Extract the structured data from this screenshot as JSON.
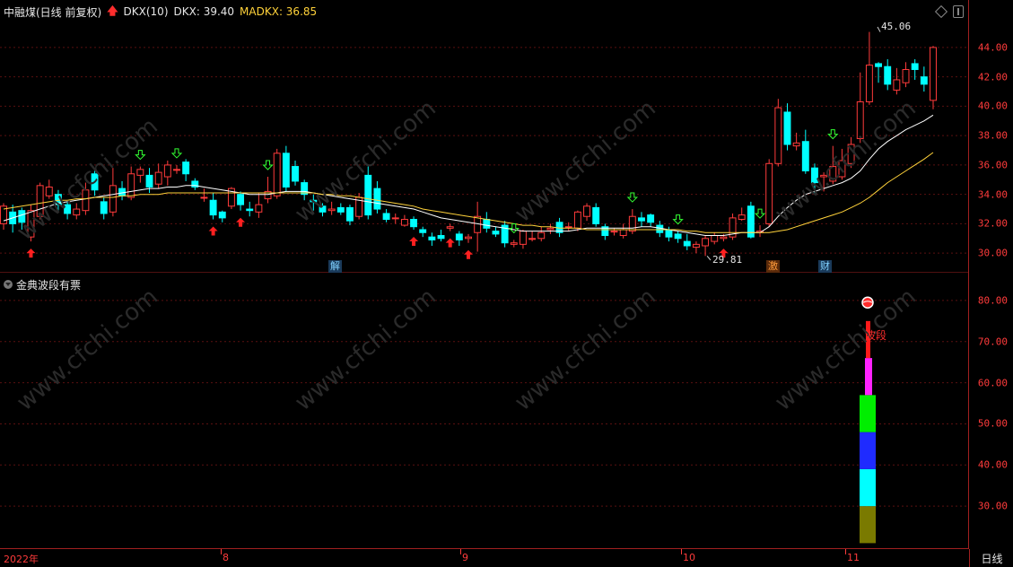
{
  "header": {
    "stock_name": "中融煤(日线 前复权)",
    "indicator_name": "DKX(10)",
    "dkx_label": "DKX: 39.40",
    "madkx_label": "MADKX: 36.85"
  },
  "sub_header": {
    "indicator_name": "金典波段有票"
  },
  "main_axis": [
    "44.00",
    "42.00",
    "40.00",
    "38.00",
    "36.00",
    "34.00",
    "32.00",
    "30.00"
  ],
  "sub_axis": [
    "80.00",
    "70.00",
    "60.00",
    "50.00",
    "40.00",
    "30.00"
  ],
  "dates": [
    "2022年",
    "8",
    "9",
    "10",
    "11"
  ],
  "period": "日线",
  "annotations": {
    "high": "45.06",
    "low": "29.81"
  },
  "markers": {
    "jie": "解",
    "ji": "激",
    "cai": "财"
  },
  "boduan_label": "波段",
  "watermark": "www.cfchi.com",
  "colors": {
    "up": "#ff3b3b",
    "down": "#00ffff",
    "dkx": "#ffffff",
    "madkx": "#ffd23a"
  },
  "chart_data": {
    "type": "candlestick",
    "ylim": [
      29.4,
      45.4
    ],
    "candles": [
      [
        32.0,
        33.2,
        33.4,
        31.6
      ],
      [
        32.8,
        32.0,
        33.3,
        31.4
      ],
      [
        32.9,
        32.1,
        33.1,
        31.6
      ],
      [
        31.1,
        32.9,
        33.3,
        30.8
      ],
      [
        32.5,
        34.6,
        34.8,
        32.3
      ],
      [
        33.9,
        34.5,
        35.0,
        33.7
      ],
      [
        34.0,
        33.3,
        34.3,
        32.9
      ],
      [
        33.3,
        32.7,
        33.5,
        32.3
      ],
      [
        32.6,
        33.0,
        33.4,
        32.3
      ],
      [
        32.9,
        34.3,
        34.8,
        32.6
      ],
      [
        35.4,
        34.3,
        35.6,
        33.9
      ],
      [
        33.5,
        32.7,
        33.8,
        32.3
      ],
      [
        32.8,
        34.6,
        35.8,
        32.5
      ],
      [
        34.4,
        33.9,
        34.9,
        33.6
      ],
      [
        33.8,
        35.4,
        35.9,
        33.6
      ],
      [
        35.3,
        35.7,
        35.9,
        34.8
      ],
      [
        35.3,
        34.5,
        35.8,
        34.1
      ],
      [
        34.7,
        35.5,
        36.1,
        34.4
      ],
      [
        35.2,
        36.0,
        36.3,
        34.6
      ],
      [
        35.7,
        35.7,
        36.0,
        35.4
      ],
      [
        36.2,
        35.4,
        36.4,
        34.9
      ],
      [
        34.9,
        34.5,
        35.1,
        34.3
      ],
      [
        33.8,
        33.8,
        34.4,
        33.5
      ],
      [
        33.6,
        32.6,
        34.1,
        32.3
      ],
      [
        32.8,
        32.4,
        32.9,
        32.1
      ],
      [
        33.2,
        34.4,
        34.5,
        33.0
      ],
      [
        34.0,
        33.3,
        34.2,
        32.9
      ],
      [
        33.0,
        32.9,
        33.5,
        32.5
      ],
      [
        32.8,
        33.3,
        34.1,
        32.4
      ],
      [
        33.7,
        34.2,
        35.2,
        33.4
      ],
      [
        33.9,
        36.8,
        37.1,
        33.7
      ],
      [
        36.8,
        34.5,
        37.3,
        34.2
      ],
      [
        35.9,
        34.9,
        36.3,
        34.6
      ],
      [
        34.8,
        34.0,
        35.0,
        33.6
      ],
      [
        33.6,
        33.5,
        34.0,
        32.9
      ],
      [
        33.2,
        32.8,
        33.4,
        32.5
      ],
      [
        32.9,
        33.0,
        33.5,
        32.6
      ],
      [
        33.1,
        32.8,
        33.4,
        32.6
      ],
      [
        33.1,
        32.2,
        33.3,
        31.9
      ],
      [
        32.5,
        33.8,
        34.1,
        32.3
      ],
      [
        35.3,
        32.6,
        35.9,
        32.3
      ],
      [
        34.4,
        33.0,
        34.9,
        32.7
      ],
      [
        32.7,
        32.3,
        33.0,
        32.1
      ],
      [
        32.4,
        32.4,
        32.7,
        32.0
      ],
      [
        31.9,
        32.3,
        32.6,
        31.8
      ],
      [
        32.3,
        31.8,
        32.5,
        31.6
      ],
      [
        31.6,
        31.4,
        31.8,
        31.1
      ],
      [
        31.1,
        30.9,
        31.4,
        30.5
      ],
      [
        31.2,
        31.0,
        31.6,
        30.8
      ],
      [
        31.7,
        31.8,
        32.0,
        31.5
      ],
      [
        31.3,
        30.9,
        31.5,
        30.5
      ],
      [
        31.0,
        31.1,
        31.3,
        30.7
      ],
      [
        31.4,
        32.5,
        33.5,
        30.1
      ],
      [
        32.3,
        31.7,
        32.8,
        31.4
      ],
      [
        31.5,
        31.3,
        31.8,
        31.1
      ],
      [
        31.9,
        30.7,
        32.2,
        30.4
      ],
      [
        30.6,
        30.7,
        30.9,
        30.4
      ],
      [
        30.6,
        31.5,
        31.6,
        30.3
      ],
      [
        31.0,
        31.0,
        31.5,
        30.8
      ],
      [
        31.0,
        31.4,
        31.8,
        30.8
      ],
      [
        31.6,
        31.7,
        32.0,
        31.3
      ],
      [
        32.1,
        31.4,
        32.4,
        31.1
      ],
      [
        31.8,
        31.8,
        32.1,
        31.5
      ],
      [
        31.7,
        32.8,
        32.9,
        31.5
      ],
      [
        32.5,
        33.2,
        33.4,
        32.2
      ],
      [
        33.1,
        32.0,
        33.4,
        31.8
      ],
      [
        31.8,
        31.2,
        32.0,
        30.9
      ],
      [
        31.5,
        31.5,
        31.7,
        31.2
      ],
      [
        31.2,
        31.6,
        32.0,
        31.0
      ],
      [
        31.5,
        32.5,
        33.0,
        31.3
      ],
      [
        32.4,
        32.2,
        32.8,
        31.8
      ],
      [
        32.6,
        32.1,
        32.7,
        31.8
      ],
      [
        31.9,
        31.4,
        32.2,
        31.1
      ],
      [
        31.6,
        31.1,
        31.8,
        30.8
      ],
      [
        31.3,
        31.0,
        31.5,
        30.7
      ],
      [
        30.8,
        30.5,
        31.3,
        30.2
      ],
      [
        30.4,
        30.6,
        30.8,
        30.0
      ],
      [
        30.5,
        31.0,
        31.2,
        29.81
      ],
      [
        30.8,
        31.2,
        31.4,
        30.6
      ],
      [
        31.0,
        31.1,
        31.3,
        30.8
      ],
      [
        31.1,
        32.4,
        32.7,
        30.9
      ],
      [
        32.3,
        32.6,
        33.1,
        32.2
      ],
      [
        33.2,
        31.1,
        33.5,
        31.0
      ],
      [
        31.4,
        31.5,
        31.9,
        31.1
      ],
      [
        32.0,
        36.1,
        36.4,
        31.8
      ],
      [
        36.1,
        39.9,
        40.5,
        35.9
      ],
      [
        39.6,
        37.4,
        40.2,
        37.0
      ],
      [
        37.3,
        37.5,
        38.2,
        37.0
      ],
      [
        37.6,
        35.6,
        38.4,
        35.4
      ],
      [
        35.8,
        34.8,
        36.1,
        34.1
      ],
      [
        35.2,
        35.3,
        35.5,
        34.2
      ],
      [
        34.9,
        35.9,
        37.3,
        34.7
      ],
      [
        35.2,
        36.3,
        37.1,
        35.0
      ],
      [
        36.1,
        37.4,
        37.9,
        35.8
      ],
      [
        37.8,
        40.3,
        42.3,
        37.5
      ],
      [
        40.3,
        42.8,
        45.06,
        40.1
      ],
      [
        42.9,
        42.7,
        43.0,
        41.6
      ],
      [
        42.7,
        41.5,
        43.2,
        41.1
      ],
      [
        41.1,
        41.8,
        42.6,
        40.8
      ],
      [
        41.6,
        42.5,
        43.0,
        41.3
      ],
      [
        42.9,
        42.5,
        43.2,
        41.8
      ],
      [
        42.0,
        41.5,
        42.7,
        41.0
      ],
      [
        40.4,
        44.0,
        44.1,
        39.8
      ]
    ],
    "dkx": [
      32.2,
      32.4,
      32.6,
      32.8,
      33.0,
      33.2,
      33.4,
      33.5,
      33.6,
      33.7,
      33.8,
      33.9,
      34.0,
      34.1,
      34.2,
      34.3,
      34.4,
      34.4,
      34.5,
      34.5,
      34.6,
      34.6,
      34.5,
      34.4,
      34.3,
      34.2,
      34.1,
      34.0,
      34.0,
      34.0,
      34.1,
      34.2,
      34.2,
      34.2,
      34.1,
      34.0,
      33.9,
      33.8,
      33.7,
      33.6,
      33.5,
      33.4,
      33.3,
      33.2,
      33.1,
      33.0,
      32.8,
      32.6,
      32.4,
      32.3,
      32.2,
      32.1,
      32.0,
      31.9,
      31.8,
      31.7,
      31.6,
      31.5,
      31.5,
      31.5,
      31.5,
      31.5,
      31.5,
      31.6,
      31.7,
      31.7,
      31.7,
      31.7,
      31.7,
      31.7,
      31.8,
      31.8,
      31.7,
      31.6,
      31.5,
      31.4,
      31.3,
      31.2,
      31.2,
      31.2,
      31.3,
      31.4,
      31.4,
      31.4,
      31.8,
      32.5,
      33.1,
      33.6,
      34.0,
      34.2,
      34.4,
      34.6,
      34.8,
      35.1,
      35.6,
      36.4,
      37.1,
      37.6,
      38.0,
      38.4,
      38.7,
      39.0,
      39.4
    ],
    "madkx": [
      33.0,
      33.1,
      33.2,
      33.3,
      33.4,
      33.5,
      33.6,
      33.6,
      33.7,
      33.7,
      33.8,
      33.8,
      33.8,
      33.9,
      33.9,
      34.0,
      34.0,
      34.0,
      34.1,
      34.1,
      34.1,
      34.1,
      34.1,
      34.1,
      34.1,
      34.1,
      34.1,
      34.1,
      34.1,
      34.1,
      34.1,
      34.1,
      34.1,
      34.1,
      34.1,
      34.0,
      34.0,
      33.9,
      33.9,
      33.8,
      33.7,
      33.6,
      33.5,
      33.4,
      33.3,
      33.2,
      33.0,
      32.9,
      32.8,
      32.7,
      32.6,
      32.5,
      32.4,
      32.3,
      32.2,
      32.1,
      32.0,
      31.9,
      31.9,
      31.8,
      31.8,
      31.7,
      31.7,
      31.7,
      31.6,
      31.6,
      31.6,
      31.6,
      31.6,
      31.6,
      31.6,
      31.6,
      31.6,
      31.6,
      31.6,
      31.5,
      31.5,
      31.4,
      31.4,
      31.4,
      31.4,
      31.4,
      31.4,
      31.4,
      31.4,
      31.5,
      31.6,
      31.8,
      32.0,
      32.2,
      32.4,
      32.6,
      32.8,
      33.1,
      33.4,
      33.8,
      34.3,
      34.8,
      35.2,
      35.6,
      36.0,
      36.4,
      36.85
    ],
    "buy_signals": [
      3,
      23,
      26,
      45,
      49,
      51,
      79
    ],
    "sell_signals": [
      15,
      19,
      29,
      56,
      69,
      74,
      83,
      91
    ],
    "sub_ylim": [
      20,
      85
    ],
    "band_segments": [
      {
        "from": 21,
        "to": 30,
        "color": "#7a7a00"
      },
      {
        "from": 30,
        "to": 39,
        "color": "#00ffff"
      },
      {
        "from": 39,
        "to": 48,
        "color": "#1f2bff"
      },
      {
        "from": 48,
        "to": 57,
        "color": "#00ee00"
      },
      {
        "from": 57,
        "to": 66,
        "color": "#ff22ff"
      },
      {
        "from": 66,
        "to": 75,
        "color": "#ff1a1a"
      }
    ]
  }
}
